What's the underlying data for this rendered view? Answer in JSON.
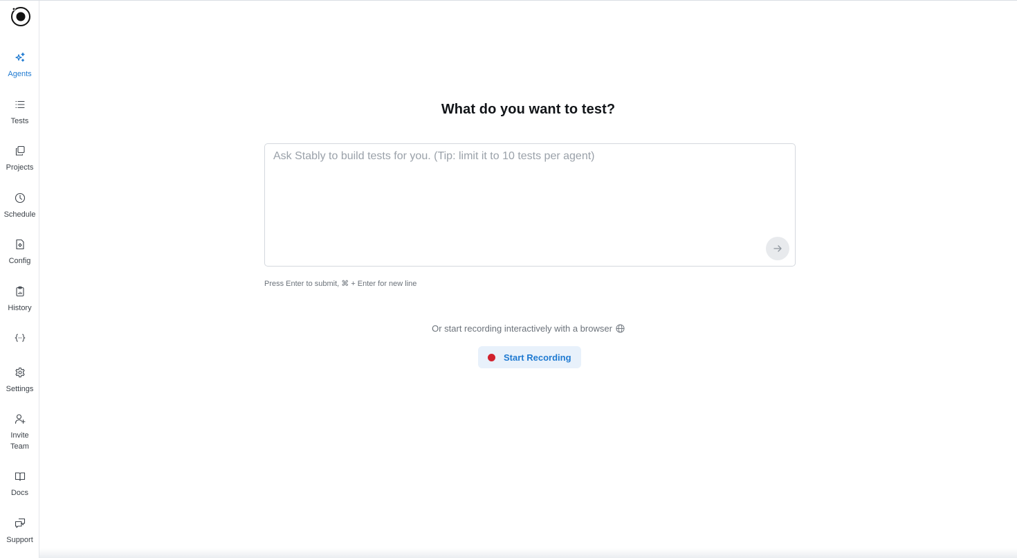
{
  "sidebar": {
    "logo": "app-logo",
    "items": [
      {
        "label": "Agents",
        "icon": "sparkles-icon",
        "active": true
      },
      {
        "label": "Tests",
        "icon": "list-icon"
      },
      {
        "label": "Projects",
        "icon": "copy-icon"
      },
      {
        "label": "Schedule",
        "icon": "clock-icon"
      },
      {
        "label": "Config",
        "icon": "config-file-icon"
      },
      {
        "label": "History",
        "icon": "clipboard-icon"
      },
      {
        "label": "",
        "icon": "braces-icon"
      },
      {
        "label": "Settings",
        "icon": "gear-icon"
      },
      {
        "label": "Invite Team",
        "icon": "user-plus-icon"
      },
      {
        "label": "Docs",
        "icon": "book-icon"
      },
      {
        "label": "Support",
        "icon": "chat-icon"
      }
    ]
  },
  "main": {
    "title": "What do you want to test?",
    "prompt_placeholder": "Ask Stably to build tests for you. (Tip: limit it to 10 tests per agent)",
    "prompt_value": "",
    "hint": "Press Enter to submit, ⌘ + Enter for new line",
    "or_text": "Or start recording interactively with a browser",
    "record_button": "Start Recording"
  },
  "colors": {
    "accent": "#1f7ad1",
    "record": "#d1222e",
    "record_bg": "#e8f1fb"
  }
}
